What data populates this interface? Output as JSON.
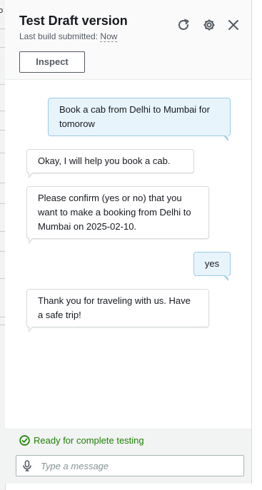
{
  "background": {
    "fragment_text": "o"
  },
  "header": {
    "title": "Test Draft version",
    "subtitle_prefix": "Last build submitted:",
    "subtitle_value": "Now",
    "inspect_label": "Inspect",
    "icons": [
      "refresh-icon",
      "settings-icon",
      "close-icon"
    ]
  },
  "messages": [
    {
      "sender": "user",
      "text": "Book a cab from Delhi to Mumbai for tomorow"
    },
    {
      "sender": "bot",
      "text": "Okay, I will help you book a cab."
    },
    {
      "sender": "bot",
      "text": "Please confirm (yes or no) that you want to make a booking from Delhi to Mumbai on 2025-02-10."
    },
    {
      "sender": "user",
      "text": "yes"
    },
    {
      "sender": "bot",
      "text": "Thank you for traveling with us. Have a safe trip!"
    }
  ],
  "footer": {
    "status_text": "Ready for complete testing",
    "status_color": "#1d8102",
    "input_placeholder": "Type a message",
    "input_value": ""
  },
  "colors": {
    "user_bubble_bg": "#e8f4fc",
    "user_bubble_border": "#99cbe4",
    "bot_bubble_bg": "#ffffff",
    "bot_bubble_border": "#d5dbdb",
    "title_text": "#16191f"
  }
}
